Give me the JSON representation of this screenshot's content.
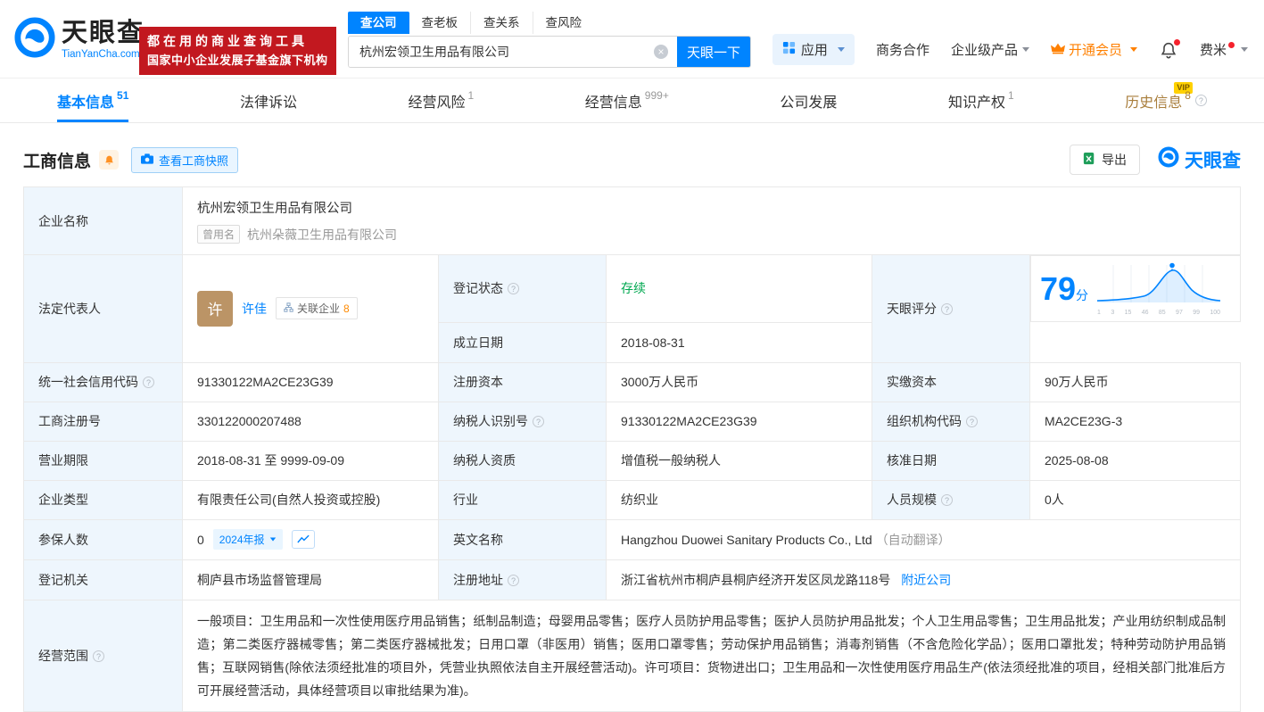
{
  "header": {
    "logo": {
      "name": "天眼查",
      "domain": "TianYanCha.com"
    },
    "banner": {
      "line1": "都在用的商业查询工具",
      "line2": "国家中小企业发展子基金旗下机构"
    },
    "search": {
      "tabs": [
        {
          "label": "查公司"
        },
        {
          "label": "查老板"
        },
        {
          "label": "查关系"
        },
        {
          "label": "查风险"
        }
      ],
      "value": "杭州宏领卫生用品有限公司",
      "button": "天眼一下"
    },
    "nav": {
      "apps": "应用",
      "cooperation": "商务合作",
      "enterprise": "企业级产品",
      "vip": "开通会员",
      "user": "费米"
    }
  },
  "tabs": [
    {
      "label": "基本信息",
      "badge": "51"
    },
    {
      "label": "法律诉讼",
      "badge": ""
    },
    {
      "label": "经营风险",
      "badge": "1"
    },
    {
      "label": "经营信息",
      "badge": "999+"
    },
    {
      "label": "公司发展",
      "badge": ""
    },
    {
      "label": "知识产权",
      "badge": "1"
    },
    {
      "label": "历史信息",
      "badge": "8",
      "vip": "VIP"
    }
  ],
  "section": {
    "title": "工商信息",
    "snapshot_button": "查看工商快照",
    "export_button": "导出",
    "brand": "天眼查"
  },
  "info": {
    "company_name": {
      "label": "企业名称",
      "value": "杭州宏领卫生用品有限公司",
      "former_tag": "曾用名",
      "former_value": "杭州朵薇卫生用品有限公司"
    },
    "legal_rep": {
      "label": "法定代表人",
      "avatar": "许",
      "name": "许佳",
      "related_label": "关联企业",
      "related_count": "8"
    },
    "reg_status": {
      "label": "登记状态",
      "value": "存续"
    },
    "establish_date": {
      "label": "成立日期",
      "value": "2018-08-31"
    },
    "score": {
      "label": "天眼评分",
      "value": "79",
      "unit": "分",
      "ticks": [
        "1",
        "3",
        "15",
        "46",
        "85",
        "97",
        "99",
        "100"
      ]
    },
    "credit_code": {
      "label": "统一社会信用代码",
      "value": "91330122MA2CE23G39"
    },
    "reg_capital": {
      "label": "注册资本",
      "value": "3000万人民币"
    },
    "paid_capital": {
      "label": "实缴资本",
      "value": "90万人民币"
    },
    "reg_number": {
      "label": "工商注册号",
      "value": "330122000207488"
    },
    "taxpayer_id": {
      "label": "纳税人识别号",
      "value": "91330122MA2CE23G39"
    },
    "org_code": {
      "label": "组织机构代码",
      "value": "MA2CE23G-3"
    },
    "business_term": {
      "label": "营业期限",
      "value": "2018-08-31 至 9999-09-09"
    },
    "taxpayer_quality": {
      "label": "纳税人资质",
      "value": "增值税一般纳税人"
    },
    "approval_date": {
      "label": "核准日期",
      "value": "2025-08-08"
    },
    "company_type": {
      "label": "企业类型",
      "value": "有限责任公司(自然人投资或控股)"
    },
    "industry": {
      "label": "行业",
      "value": "纺织业"
    },
    "staff_size": {
      "label": "人员规模",
      "value": "0人"
    },
    "insured": {
      "label": "参保人数",
      "value": "0",
      "report_tag": "2024年报"
    },
    "english_name": {
      "label": "英文名称",
      "value": "Hangzhou Duowei Sanitary Products Co., Ltd",
      "auto_tag": "（自动翻译）"
    },
    "reg_authority": {
      "label": "登记机关",
      "value": "桐庐县市场监督管理局"
    },
    "reg_address": {
      "label": "注册地址",
      "value": "浙江省杭州市桐庐县桐庐经济开发区凤龙路118号",
      "nearby_link": "附近公司"
    },
    "business_scope": {
      "label": "经营范围",
      "value": "一般项目：卫生用品和一次性使用医疗用品销售；纸制品制造；母婴用品零售；医疗人员防护用品零售；医护人员防护用品批发；个人卫生用品零售；卫生用品批发；产业用纺织制成品制造；第二类医疗器械零售；第二类医疗器械批发；日用口罩（非医用）销售；医用口罩零售；劳动保护用品销售；消毒剂销售（不含危险化学品）；医用口罩批发；特种劳动防护用品销售；互联网销售(除依法须经批准的项目外，凭营业执照依法自主开展经营活动)。许可项目：货物进出口；卫生用品和一次性使用医疗用品生产(依法须经批准的项目，经相关部门批准后方可开展经营活动，具体经营项目以审批结果为准)。"
    }
  },
  "colors": {
    "accent_blue": "#0084ff",
    "status_green": "#00a850",
    "banner_red": "#c2181f",
    "vip_orange": "#ff8000",
    "history_gold": "#a97e3c"
  }
}
